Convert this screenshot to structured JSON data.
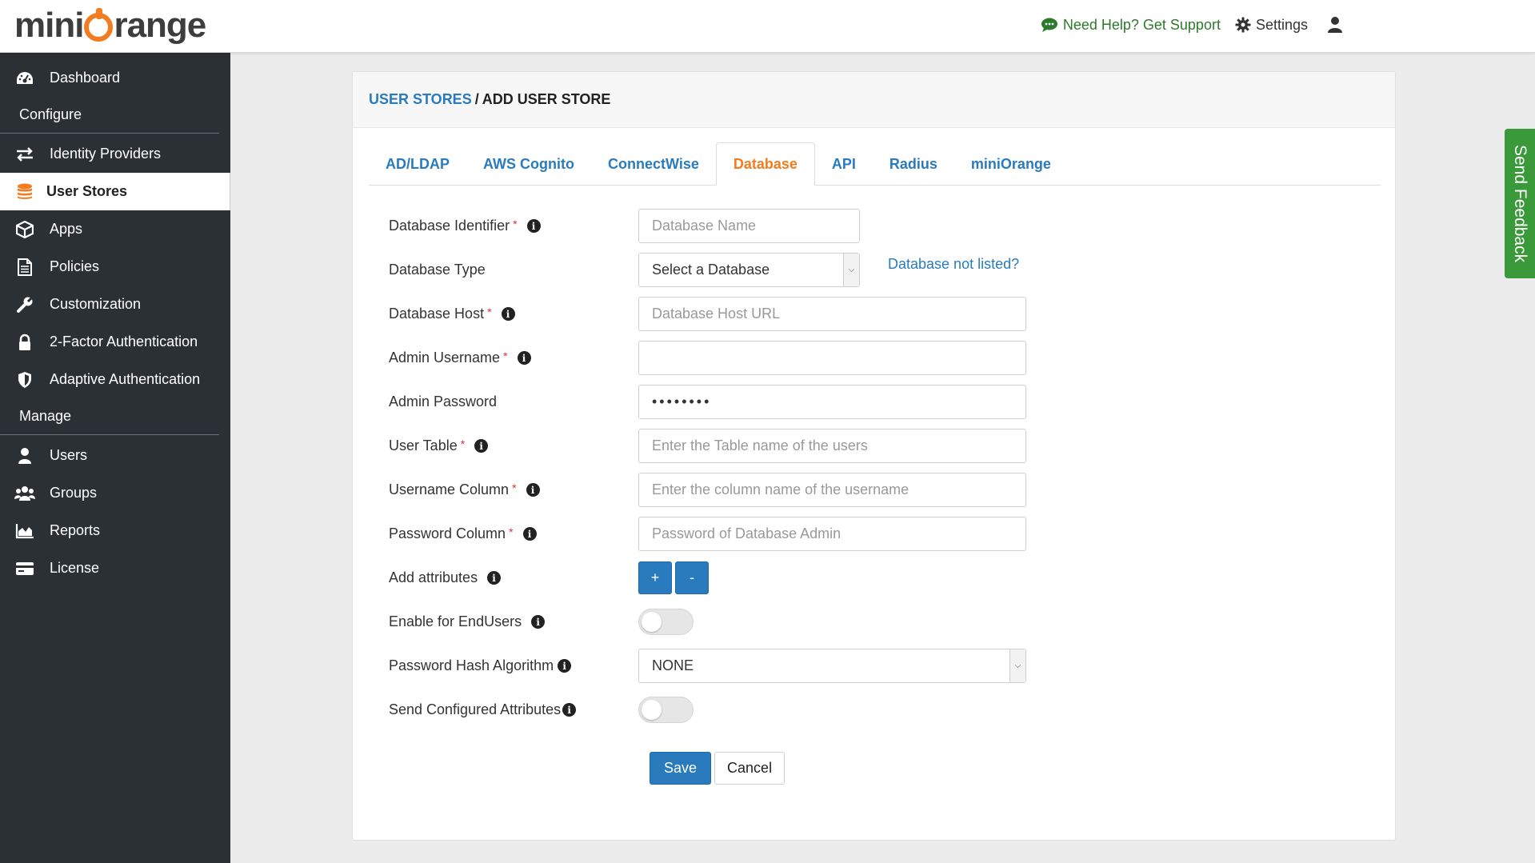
{
  "header": {
    "logo_prefix": "mini",
    "logo_suffix": "range",
    "help_text": "Need Help? Get Support",
    "settings_label": "Settings"
  },
  "sidebar": {
    "dashboard": "Dashboard",
    "configure_heading": "Configure",
    "identity_providers": "Identity Providers",
    "user_stores": "User Stores",
    "apps": "Apps",
    "policies": "Policies",
    "customization": "Customization",
    "two_factor": "2-Factor Authentication",
    "adaptive": "Adaptive Authentication",
    "manage_heading": "Manage",
    "users": "Users",
    "groups": "Groups",
    "reports": "Reports",
    "license": "License"
  },
  "breadcrumb": {
    "link": "USER STORES",
    "separator": "/",
    "current": "ADD USER STORE"
  },
  "tabs": [
    "AD/LDAP",
    "AWS Cognito",
    "ConnectWise",
    "Database",
    "API",
    "Radius",
    "miniOrange"
  ],
  "active_tab": "Database",
  "form": {
    "db_identifier": {
      "label": "Database Identifier",
      "placeholder": "Database Name",
      "required": "*"
    },
    "db_type": {
      "label": "Database Type",
      "value": "Select a Database",
      "link": "Database not listed?"
    },
    "db_host": {
      "label": "Database Host",
      "placeholder": "Database Host URL",
      "required": "*"
    },
    "admin_username": {
      "label": "Admin Username",
      "value": "",
      "required": "*"
    },
    "admin_password": {
      "label": "Admin Password",
      "value": "••••••••"
    },
    "user_table": {
      "label": "User Table",
      "placeholder": "Enter the Table name of the users",
      "required": "*"
    },
    "username_column": {
      "label": "Username Column",
      "placeholder": "Enter the column name of the username",
      "required": "*"
    },
    "password_column": {
      "label": "Password Column",
      "placeholder": "Password of Database Admin",
      "required": "*"
    },
    "add_attributes": {
      "label": "Add attributes",
      "plus": "+",
      "minus": "-"
    },
    "enable_endusers": {
      "label": "Enable for EndUsers",
      "enabled": false
    },
    "hash_algorithm": {
      "label": "Password Hash Algorithm",
      "value": "NONE"
    },
    "send_attributes": {
      "label": "Send Configured Attributes",
      "enabled": false
    },
    "save_label": "Save",
    "cancel_label": "Cancel"
  },
  "feedback_label": "Send Feedback",
  "colors": {
    "accent_blue": "#2a7bbd",
    "brand_orange": "#f27c1f",
    "sidebar_bg": "#2b3035",
    "feedback_green": "#3a9a3a"
  }
}
